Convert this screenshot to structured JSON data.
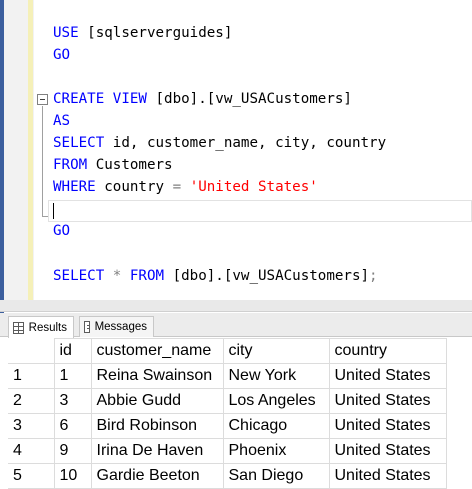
{
  "editor": {
    "lines": {
      "use_kw": "USE",
      "use_db": " [sqlserverguides]",
      "go1": "GO",
      "create_kw": "CREATE VIEW",
      "create_obj": " [dbo].[vw_USACustomers]",
      "as_kw": "AS",
      "select_kw": "SELECT",
      "select_cols": " id, customer_name, city, country",
      "from_kw": "FROM",
      "from_table": " Customers",
      "where_kw": "WHERE",
      "where_col": " country ",
      "where_op": "=",
      "where_val": "'United States'",
      "go2": "GO",
      "sel2_kw": "SELECT",
      "sel2_star": " * ",
      "sel2_from": "FROM",
      "sel2_obj": " [dbo].[vw_USACustomers]",
      "sel2_end": ";"
    }
  },
  "tabs": {
    "results_label": "Results",
    "messages_label": "Messages"
  },
  "results": {
    "columns": [
      "id",
      "customer_name",
      "city",
      "country"
    ],
    "rows": [
      {
        "n": "1",
        "id": "1",
        "customer_name": "Reina Swainson",
        "city": "New York",
        "country": "United States"
      },
      {
        "n": "2",
        "id": "3",
        "customer_name": "Abbie Gudd",
        "city": "Los Angeles",
        "country": "United States"
      },
      {
        "n": "3",
        "id": "6",
        "customer_name": "Bird Robinson",
        "city": "Chicago",
        "country": "United States"
      },
      {
        "n": "4",
        "id": "9",
        "customer_name": "Irina De Haven",
        "city": "Phoenix",
        "country": "United States"
      },
      {
        "n": "5",
        "id": "10",
        "customer_name": "Gardie Beeton",
        "city": "San Diego",
        "country": "United States"
      }
    ]
  },
  "colors": {
    "keyword": "#0000ff",
    "string": "#ff0000",
    "operator": "#808080"
  },
  "icons": {
    "results_tab_icon": "grid-icon",
    "messages_tab_icon": "message-icon",
    "collapse_icon": "collapse-minus-icon"
  }
}
